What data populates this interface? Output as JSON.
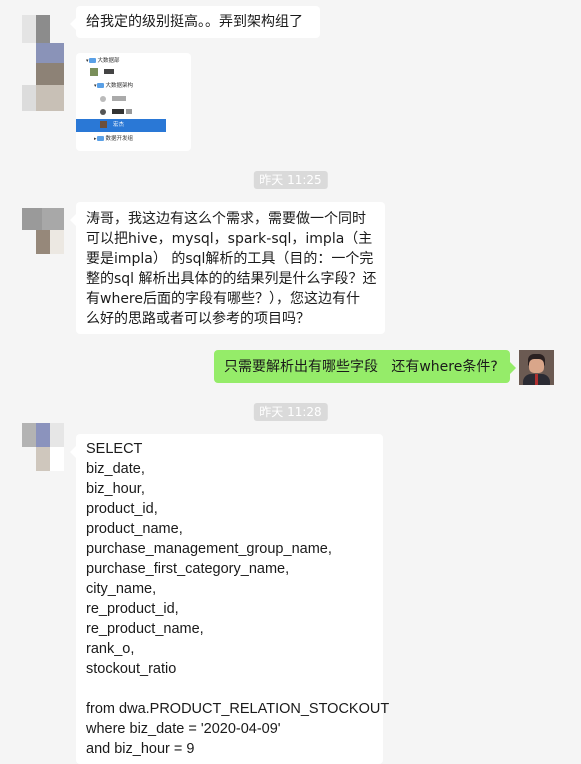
{
  "messages": {
    "m1": {
      "text": "给我定的级别挺高。。弄到架构组了"
    },
    "m2": {
      "image": {
        "root_label": "大数据部",
        "arch_label": "大数据架构",
        "selected_label": "宏杰",
        "devgroup_label": "数据开发组"
      }
    },
    "t1": {
      "time": "昨天 11:25"
    },
    "m3": {
      "lines": [
        "涛哥，我这边有这么个需求，需要做一个同时",
        "可以把hive，mysql，spark-sql，impla（主",
        "要是impla） 的sql解析的工具（目的：一个完",
        "整的sql 解析出具体的的结果列是什么字段？还",
        "有where后面的字段有哪些？），您这边有什",
        "么好的思路或者可以参考的项目吗？"
      ]
    },
    "m4": {
      "text": "只需要解析出有哪些字段   还有where条件?"
    },
    "t2": {
      "time": "昨天 11:28"
    },
    "m5": {
      "lines": [
        "SELECT",
        "biz_date,",
        "biz_hour,",
        "product_id,",
        "product_name,",
        "purchase_management_group_name,",
        "purchase_first_category_name,",
        "city_name,",
        "re_product_id,",
        "re_product_name,",
        "rank_o,",
        "stockout_ratio",
        "",
        "from dwa.PRODUCT_RELATION_STOCKOUT",
        "where biz_date = '2020-04-09'",
        "and biz_hour = 9"
      ]
    }
  },
  "colors": {
    "background": "#f5f5f5",
    "bubble_in": "#ffffff",
    "bubble_out": "#95ec69",
    "time_badge": "#dadada"
  }
}
